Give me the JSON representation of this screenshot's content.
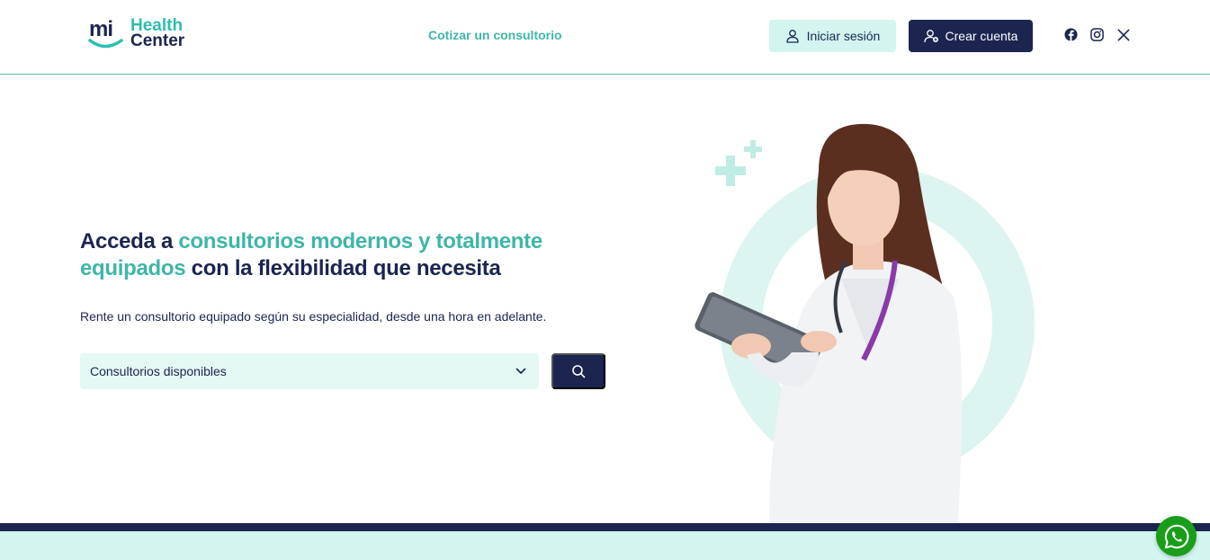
{
  "brand": {
    "logo_mark": "mi",
    "logo_line1": "Health",
    "logo_line2": "Center"
  },
  "nav": {
    "quote_link": "Cotizar un consultorio"
  },
  "auth": {
    "login_label": "Iniciar sesión",
    "register_label": "Crear cuenta"
  },
  "socials": [
    "facebook-icon",
    "instagram-icon",
    "x-icon"
  ],
  "hero": {
    "title_part1": "Acceda a ",
    "title_accent1": "consultorios modernos y totalmente equipados",
    "title_part2": " con la flexibilidad que necesita",
    "subtitle": "Rente un consultorio equipado según su especialidad, desde una hora en adelante."
  },
  "search": {
    "select_value": "Consultorios disponibles"
  },
  "colors": {
    "navy": "#1b2550",
    "teal": "#3fb6a8",
    "mint": "#d2f5ef",
    "whatsapp": "#1a9e1a"
  }
}
